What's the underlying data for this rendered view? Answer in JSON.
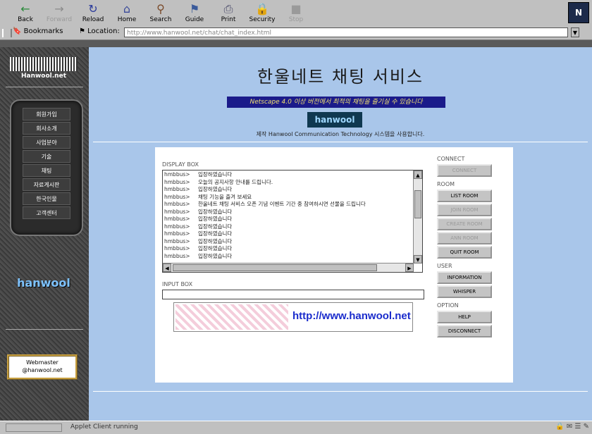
{
  "toolbar": {
    "buttons": [
      {
        "label": "Back",
        "enabled": true
      },
      {
        "label": "Forward",
        "enabled": false
      },
      {
        "label": "Reload",
        "enabled": true
      },
      {
        "label": "Home",
        "enabled": true
      },
      {
        "label": "Search",
        "enabled": true
      },
      {
        "label": "Guide",
        "enabled": true
      },
      {
        "label": "Print",
        "enabled": true
      },
      {
        "label": "Security",
        "enabled": true
      },
      {
        "label": "Stop",
        "enabled": false
      }
    ],
    "brand_letter": "N"
  },
  "locbar": {
    "bookmarks_label": "Bookmarks",
    "location_label": "Location:",
    "url": "http://www.hanwool.net/chat/chat_index.html"
  },
  "sidebar": {
    "logo_text": "Hanwool.net",
    "menu": [
      "회원가입",
      "회사소개",
      "사업분야",
      "기술",
      "채팅",
      "자료게시판",
      "한국인물",
      "고객센터"
    ],
    "bottom_logo": "hanwool",
    "webmaster": [
      "Webmaster",
      "@hanwool.net"
    ]
  },
  "main": {
    "title": "한울네트 채팅 서비스",
    "notice": "Netscape 4.0 이상 버전에서 최적의 채팅을 즐기실 수 있습니다",
    "small_logo": "hanwool",
    "credit": "제작 Hanwool Communication Technology 시스템을 사용합니다."
  },
  "applet": {
    "display_label": "DISPLAY BOX",
    "display_lines": [
      {
        "nick": "hmbbus>",
        "text": "입장하였습니다"
      },
      {
        "nick": "hmbbus>",
        "text": "오늘의 공지사항 안내를 드립니다."
      },
      {
        "nick": "hmbbus>",
        "text": "입장하였습니다"
      },
      {
        "nick": "hmbbus>",
        "text": "채팅 기능을 즐겨 보세요"
      },
      {
        "nick": "hmbbus>",
        "text": "한울네트 채팅 서비스 오픈 기념 이벤트 기간 중 참여하시면 선물을 드립니다"
      },
      {
        "nick": "hmbbus>",
        "text": "입장하였습니다"
      },
      {
        "nick": "hmbbus>",
        "text": "입장하였습니다"
      },
      {
        "nick": "hmbbus>",
        "text": "입장하였습니다"
      },
      {
        "nick": "hmbbus>",
        "text": "입장하였습니다"
      },
      {
        "nick": "hmbbus>",
        "text": "입장하였습니다"
      },
      {
        "nick": "hmbbus>",
        "text": "입장하였습니다"
      },
      {
        "nick": "hmbbus>",
        "text": "입장하였습니다"
      }
    ],
    "input_label": "INPUT BOX",
    "input_value": "",
    "banner_url": "http://www.hanwool.net",
    "groups": [
      {
        "label": "CONNECT",
        "buttons": [
          {
            "label": "CONNECT",
            "enabled": false
          }
        ]
      },
      {
        "label": "ROOM",
        "buttons": [
          {
            "label": "LIST ROOM",
            "enabled": true
          },
          {
            "label": "JOIN ROOM",
            "enabled": false
          },
          {
            "label": "CREATE ROOM",
            "enabled": false
          },
          {
            "label": "ANN ROOM",
            "enabled": false
          },
          {
            "label": "QUIT ROOM",
            "enabled": true
          }
        ]
      },
      {
        "label": "USER",
        "buttons": [
          {
            "label": "INFORMATION",
            "enabled": true
          },
          {
            "label": "WHISPER",
            "enabled": true
          }
        ]
      },
      {
        "label": "OPTION",
        "buttons": [
          {
            "label": "HELP",
            "enabled": true
          },
          {
            "label": "DISCONNECT",
            "enabled": true
          }
        ]
      }
    ]
  },
  "status": {
    "text": "Applet Client running"
  }
}
